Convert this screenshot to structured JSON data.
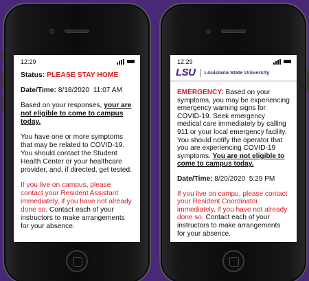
{
  "colors": {
    "background": "#4a2878",
    "alert_red": "#d41e26",
    "lsu_purple": "#461d7c"
  },
  "left_phone": {
    "time": "12:29",
    "status_label": "Status:",
    "status_value": "PLEASE STAY HOME",
    "datetime_label": "Date/Time:",
    "datetime_value": "8/18/2020  11:07 AM",
    "responses_text": "Based on your responses,",
    "not_eligible_text": "your are not eligible to come to campus today.",
    "symptoms_text": "You have one or more symptoms that may be related to COVID-19. You should contact the Student Health Center or your healthcare provider, and, if directed, get tested.",
    "campus_red_text": "If you live on campus, please contact your Resident Assistant immediately, if you have not already done so.",
    "instructors_text": "Contact each of your instructors to make arrangements for your absence."
  },
  "right_phone": {
    "time": "12:29",
    "logo_text": "LSU",
    "university_name": "Louisiana State University",
    "emergency_label": "EMERGENCY:",
    "emergency_text": "Based on your symptoms, you may be experiencing emergency warning signs for COVID-19. Seek emergency medical care immediately by calling 911 or your local emergency facility. You should notify the operator that you are experiencing COVID-19 symptoms.",
    "not_eligible_text": "You are not eligible to come to campus today.",
    "datetime_label": "Date/Time:",
    "datetime_value": "8/20/2020  5:29 PM",
    "campus_red_text": "If you live on campu, please contact your Resident Coordinator immediately, if you have not already done so.",
    "instructors_text": "Contact each of your instructors to make arrangements for your absence."
  }
}
